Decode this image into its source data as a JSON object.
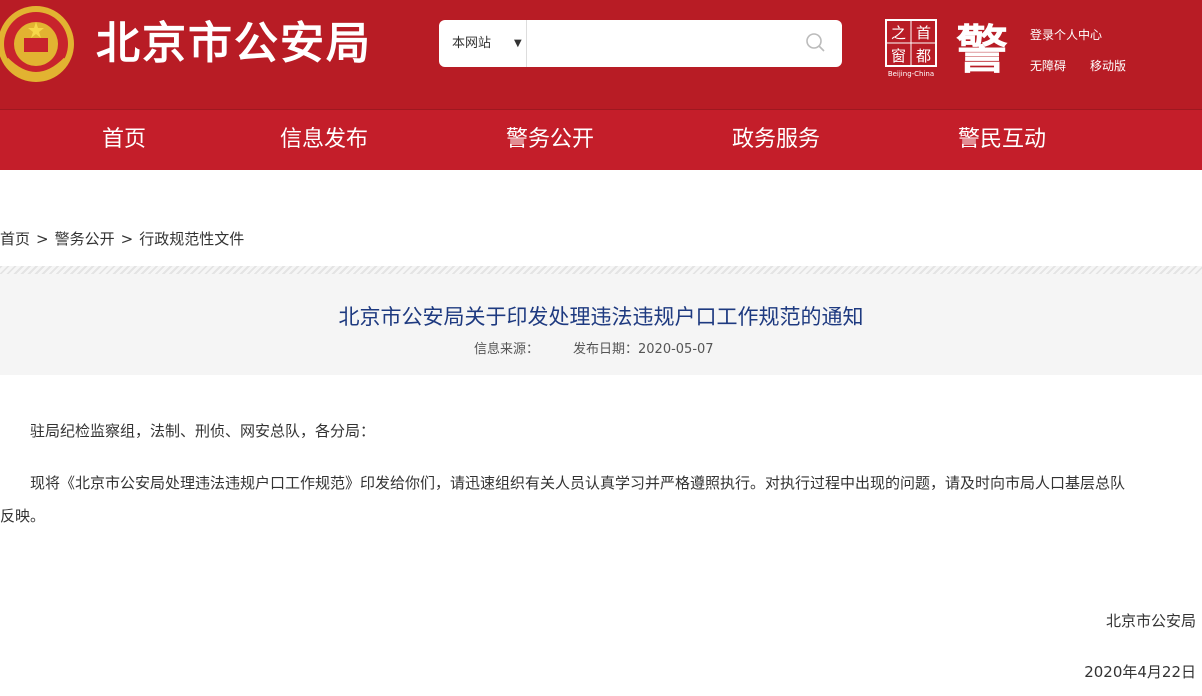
{
  "header": {
    "site_title": "北京市公安局",
    "search": {
      "scope": "本网站",
      "value": ""
    },
    "links": {
      "login": "登录个人中心",
      "accessibility": "无障碍",
      "mobile": "移动版"
    },
    "capital_window": {
      "chars": [
        "首",
        "都",
        "之",
        "窗"
      ],
      "caption": "Beijing-China"
    },
    "police_char": "警"
  },
  "nav": [
    "首页",
    "信息发布",
    "警务公开",
    "政务服务",
    "警民互动"
  ],
  "breadcrumb": [
    "首页",
    "警务公开",
    "行政规范性文件"
  ],
  "breadcrumb_separator": ">",
  "article": {
    "title": "北京市公安局关于印发处理违法违规户口工作规范的通知",
    "source_label": "信息来源：",
    "date_label": "发布日期：2020-05-07",
    "greeting": "驻局纪检监察组，法制、刑侦、网安总队，各分局：",
    "body_line1": "现将《北京市公安局处理违法违规户口工作规范》印发给你们，请迅速组织有关人员认真学习并严格遵照执行。对执行过程中出现的问题，请及时向市局人口基层总队",
    "body_line2": "反映。",
    "signature": "北京市公安局",
    "signature_date": "2020年4月22日"
  },
  "colors": {
    "header_red": "#b81c25",
    "nav_red": "#c41e2a",
    "title_blue": "#1e3a80",
    "gold": "#f2c32c"
  }
}
